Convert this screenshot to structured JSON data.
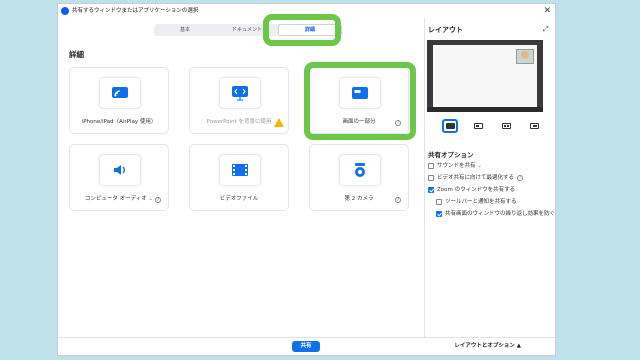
{
  "window": {
    "title": "共有するウィンドウまたはアプリケーションの選択",
    "close_glyph": "✕"
  },
  "tabs": [
    {
      "label": "基本"
    },
    {
      "label": "ドキュメント"
    },
    {
      "label": "詳細"
    }
  ],
  "section_title": "詳細",
  "tiles": [
    {
      "label": "iPhone/iPad（AirPlay 使用）",
      "icon": "airplay-icon"
    },
    {
      "label": "PowerPoint を背景に使用",
      "icon": "powerpoint-background-icon"
    },
    {
      "label": "画面の一部分",
      "icon": "screen-portion-icon"
    },
    {
      "label": "コンピュータ オーディオ",
      "icon": "speaker-icon"
    },
    {
      "label": "ビデオファイル",
      "icon": "film-icon"
    },
    {
      "label": "第 2 カメラ",
      "icon": "camera-icon"
    }
  ],
  "right_panel": {
    "layout_title": "レイアウト",
    "options_title": "共有オプション",
    "options": [
      {
        "label": "サウンドを共有",
        "checked": false
      },
      {
        "label": "ビデオ共有に向けて最適化する",
        "checked": false
      },
      {
        "label": "Zoom のウィンドウを共有する",
        "checked": true
      },
      {
        "label": "ツールバーと通知を共有する",
        "checked": false
      },
      {
        "label": "共有画面のウィンドウの繰り返し効果を防ぐ",
        "checked": true
      }
    ]
  },
  "bottom": {
    "share_label": "共有",
    "layout_options_label": "レイアウトとオプション ▲"
  },
  "colors": {
    "accent": "#0e71eb",
    "highlight": "#6cc64a",
    "background": "#bfe2ea"
  }
}
